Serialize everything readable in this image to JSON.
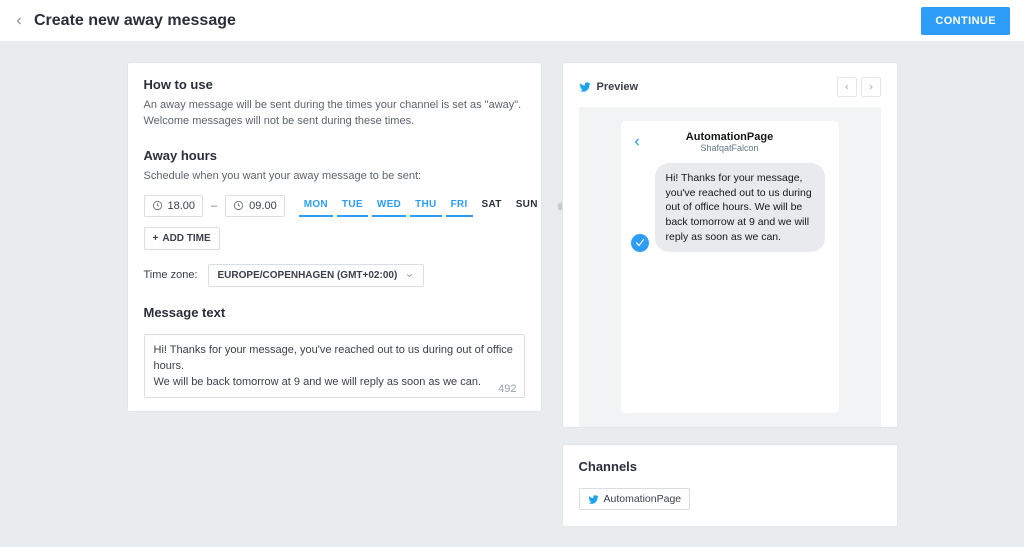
{
  "topbar": {
    "title": "Create new away message",
    "continue_label": "CONTINUE"
  },
  "how_to_use": {
    "title": "How to use",
    "body": "An away message will be sent during the times your channel is set as \"away\". Welcome messages will not be sent during these times."
  },
  "away_hours": {
    "title": "Away hours",
    "subtitle": "Schedule when you want your away message to be sent:",
    "from": "18.00",
    "to": "09.00",
    "days": [
      {
        "label": "MON",
        "on": true
      },
      {
        "label": "TUE",
        "on": true
      },
      {
        "label": "WED",
        "on": true
      },
      {
        "label": "THU",
        "on": true
      },
      {
        "label": "FRI",
        "on": true
      },
      {
        "label": "SAT",
        "on": false
      },
      {
        "label": "SUN",
        "on": false
      }
    ],
    "add_time_label": "ADD TIME",
    "tz_label": "Time zone:",
    "tz_value": "EUROPE/COPENHAGEN (GMT+02:00)"
  },
  "message_text": {
    "title": "Message text",
    "value": "Hi! Thanks for your message, you've reached out to us during out of office hours.\nWe will be back tomorrow at 9 and we will reply as soon as we can.",
    "remaining": "492"
  },
  "preview": {
    "label": "Preview",
    "page_title": "AutomationPage",
    "page_handle": "ShafqatFalcon",
    "bubble": "Hi! Thanks for your message, you've reached out to us during out of office hours. We will be back tomorrow at 9 and we will reply as soon as we can."
  },
  "channels": {
    "title": "Channels",
    "item": "AutomationPage"
  }
}
